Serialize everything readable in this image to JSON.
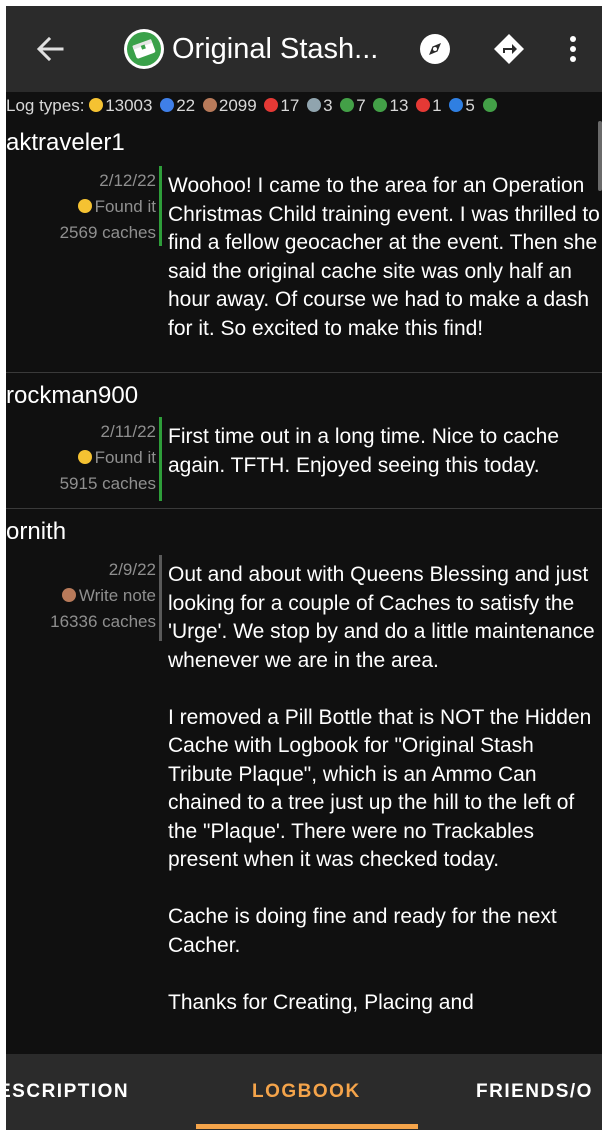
{
  "appbar": {
    "title": "Original Stash...",
    "back_icon": "arrow-back-icon",
    "cache_icon": "traditional-cache-icon",
    "compass_icon": "compass-icon",
    "navigate_icon": "navigate-icon",
    "more_icon": "more-vert-icon"
  },
  "log_types": {
    "label": "Log types:",
    "items": [
      {
        "icon": "found-it-icon",
        "count": "13003"
      },
      {
        "icon": "didnt-find-icon",
        "count": "22"
      },
      {
        "icon": "write-note-icon",
        "count": "2099"
      },
      {
        "icon": "needs-maintenance-icon",
        "count": "17"
      },
      {
        "icon": "temporarily-disabled-icon",
        "count": "3"
      },
      {
        "icon": "enabled-icon",
        "count": "7"
      },
      {
        "icon": "published-icon",
        "count": "13"
      },
      {
        "icon": "archived-icon",
        "count": "1"
      },
      {
        "icon": "owner-maintenance-icon",
        "count": "5"
      },
      {
        "icon": "update-coordinates-icon",
        "count": ""
      }
    ]
  },
  "logs": [
    {
      "author": "aktraveler1",
      "date": "2/12/22",
      "type": "Found it",
      "caches": "2569 caches",
      "paragraphs": [
        "Woohoo! I came to the area for an Operation Christmas Child training event. I was thrilled to find a fellow geocacher at the event. Then she said the original cache site was only half an hour away. Of course we had to make a dash for it. So excited to make this find!"
      ]
    },
    {
      "author": "rockman900",
      "date": "2/11/22",
      "type": "Found it",
      "caches": "5915 caches",
      "paragraphs": [
        "First time out in a long time. Nice to cache again. TFTH. Enjoyed seeing this today."
      ]
    },
    {
      "author": "ornith",
      "date": "2/9/22",
      "type": "Write note",
      "caches": "16336 caches",
      "paragraphs": [
        "Out and about with Queens Blessing and just looking for a couple of Caches to satisfy the 'Urge'. We stop by and do a little maintenance whenever we are in the area.",
        "I removed a Pill Bottle that is NOT the Hidden Cache with Logbook for \"Original Stash Tribute Plaque\", which is an Ammo Can chained to a tree just up the hill to the left of the \"Plaque'. There were no Trackables present when it was checked today.",
        "Cache is doing fine and ready for the next Cacher.",
        "Thanks for Creating, Placing and"
      ]
    }
  ],
  "tabs": [
    {
      "label": "ESCRIPTION",
      "active": false
    },
    {
      "label": "LOGBOOK",
      "active": true
    },
    {
      "label": "FRIENDS/O",
      "active": false
    }
  ],
  "colors": {
    "accent": "#f5a44a",
    "found_bar": "#2e9e3a",
    "appbar": "#2b2b2b",
    "background": "#101010"
  }
}
